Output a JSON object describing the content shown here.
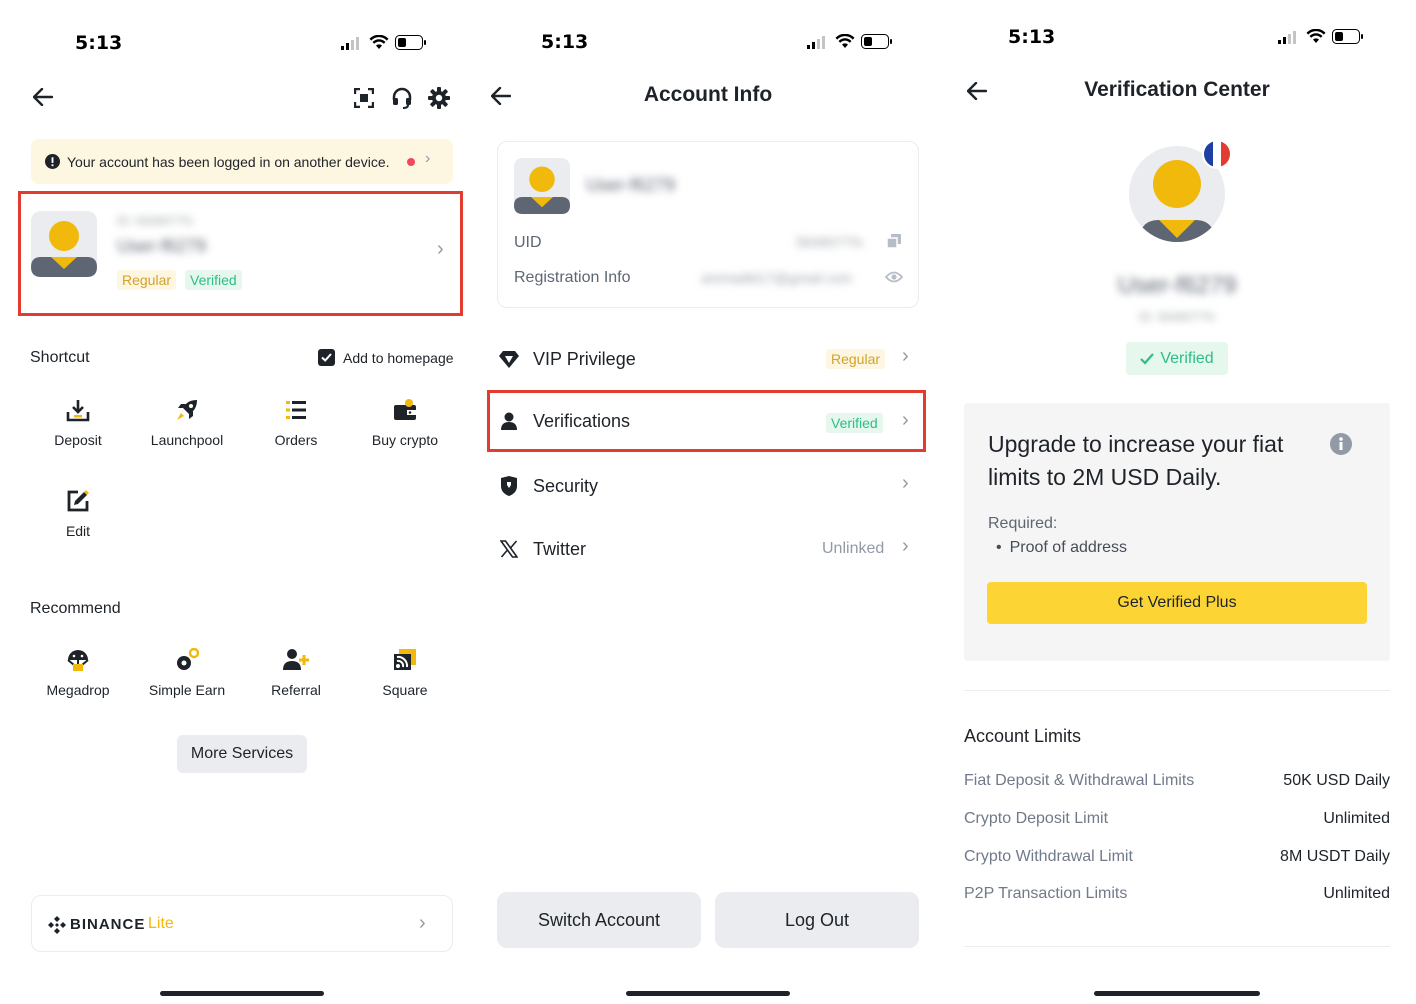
{
  "status_bar": {
    "time": "5:13"
  },
  "screen1": {
    "notice": "Your account has been logged in on another device.",
    "profile": {
      "uid_blurred": "ID: 5649077%",
      "name_blurred": "User-f6279",
      "tag_regular": "Regular",
      "tag_verified": "Verified"
    },
    "shortcut_title": "Shortcut",
    "add_to_homepage": "Add to homepage",
    "shortcuts": [
      "Deposit",
      "Launchpool",
      "Orders",
      "Buy crypto",
      "Edit"
    ],
    "recommend_title": "Recommend",
    "recommend": [
      "Megadrop",
      "Simple Earn",
      "Referral",
      "Square"
    ],
    "more_services": "More Services",
    "brand": {
      "name": "BINANCE",
      "suffix": "Lite"
    }
  },
  "screen2": {
    "title": "Account Info",
    "card": {
      "name_blurred": "User-f6279",
      "uid_label": "UID",
      "uid_blurred": "5649077%",
      "reg_label": "Registration Info",
      "reg_blurred": "ammadld17@gmail.com"
    },
    "menu": [
      {
        "label": "VIP Privilege",
        "value": "Regular"
      },
      {
        "label": "Verifications",
        "value": "Verified"
      },
      {
        "label": "Security",
        "value": ""
      },
      {
        "label": "Twitter",
        "value": "Unlinked"
      }
    ],
    "switch_account": "Switch Account",
    "log_out": "Log Out"
  },
  "screen3": {
    "title": "Verification Center",
    "name_blurred": "User-f6279",
    "id_blurred": "ID: 5649077%",
    "verified": "Verified",
    "upgrade_text": "Upgrade to increase your fiat limits to 2M USD Daily.",
    "required_label": "Required:",
    "required_item": "Proof of address",
    "cta": "Get Verified Plus",
    "limits_title": "Account Limits",
    "limits": [
      {
        "label": "Fiat Deposit & Withdrawal Limits",
        "value": "50K USD Daily"
      },
      {
        "label": "Crypto Deposit Limit",
        "value": "Unlimited"
      },
      {
        "label": "Crypto Withdrawal Limit",
        "value": "8M USDT Daily"
      },
      {
        "label": "P2P Transaction Limits",
        "value": "Unlimited"
      }
    ]
  },
  "colors": {
    "accent": "#fcd535",
    "brand_yellow": "#f0b90b",
    "green": "#2ebd85",
    "red_highlight": "#e23b2f"
  },
  "icons": [
    "back-arrow-icon",
    "scan-icon",
    "headset-icon",
    "gear-icon",
    "info-icon",
    "chevron-right-icon",
    "copy-icon",
    "eye-icon",
    "diamond-icon",
    "person-icon",
    "shield-icon",
    "x-logo-icon",
    "france-flag-icon",
    "check-icon"
  ]
}
